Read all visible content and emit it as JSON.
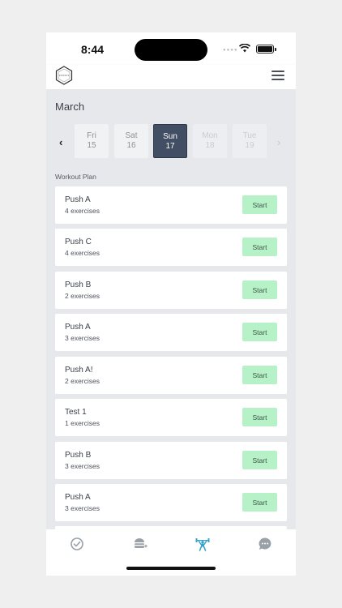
{
  "status_bar": {
    "time": "8:44"
  },
  "header": {
    "logo_icon": "brand-hexagon-logo",
    "menu_icon": "hamburger-menu-icon"
  },
  "calendar": {
    "month": "March",
    "prev_icon": "chevron-left-icon",
    "next_icon": "chevron-right-icon",
    "days": [
      {
        "name": "Fri",
        "num": "15",
        "state": "normal"
      },
      {
        "name": "Sat",
        "num": "16",
        "state": "normal"
      },
      {
        "name": "Sun",
        "num": "17",
        "state": "selected"
      },
      {
        "name": "Mon",
        "num": "18",
        "state": "disabled"
      },
      {
        "name": "Tue",
        "num": "19",
        "state": "disabled"
      }
    ]
  },
  "workout_plan": {
    "label": "Workout Plan",
    "start_label": "Start",
    "items": [
      {
        "name": "Push A",
        "count": "4 exercises"
      },
      {
        "name": "Push C",
        "count": "4 exercises"
      },
      {
        "name": "Push B",
        "count": "2 exercises"
      },
      {
        "name": "Push A",
        "count": "3 exercises"
      },
      {
        "name": "Push A!",
        "count": "2 exercises"
      },
      {
        "name": "Test 1",
        "count": "1 exercises"
      },
      {
        "name": "Push B",
        "count": "3 exercises"
      },
      {
        "name": "Push A",
        "count": "3 exercises"
      }
    ]
  },
  "tab_bar": {
    "tabs": [
      {
        "icon": "check-circle-icon",
        "active": false
      },
      {
        "icon": "burger-add-icon",
        "active": false
      },
      {
        "icon": "weightlifter-icon",
        "active": true
      },
      {
        "icon": "chat-bubble-icon",
        "active": false
      }
    ]
  },
  "colors": {
    "selected_day": "#424e63",
    "start_button": "#b6f1c8",
    "active_tab": "#38a3c7",
    "inactive_tab": "#9aa0a8",
    "content_bg": "#e6e8ec"
  }
}
